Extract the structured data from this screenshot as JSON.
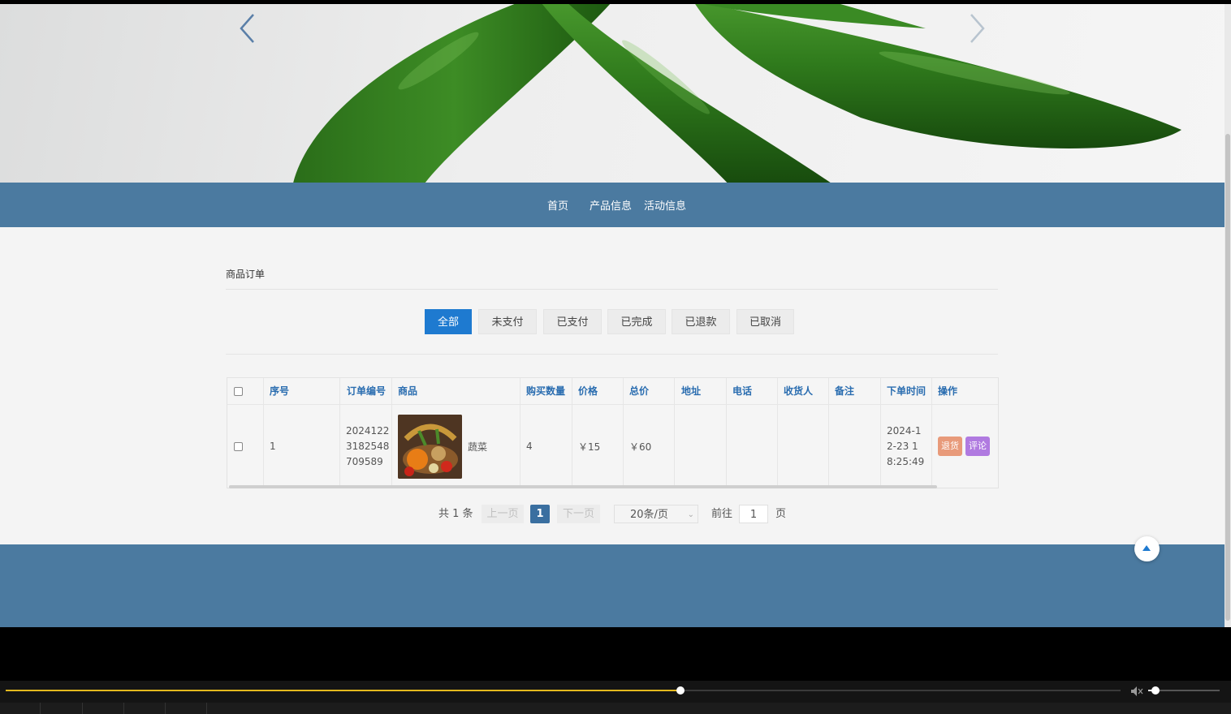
{
  "nav": {
    "items": [
      "首页",
      "产品信息",
      "活动信息"
    ]
  },
  "section": {
    "title": "商品订单"
  },
  "tabs": [
    {
      "label": "全部",
      "active": true
    },
    {
      "label": "未支付",
      "active": false
    },
    {
      "label": "已支付",
      "active": false
    },
    {
      "label": "已完成",
      "active": false
    },
    {
      "label": "已退款",
      "active": false
    },
    {
      "label": "已取消",
      "active": false
    }
  ],
  "table": {
    "headers": [
      "序号",
      "订单编号",
      "商品",
      "购买数量",
      "价格",
      "总价",
      "地址",
      "电话",
      "收货人",
      "备注",
      "下单时间",
      "操作"
    ],
    "rows": [
      {
        "index": "1",
        "order_no": "20241223182548709589",
        "product": "蔬菜",
        "quantity": "4",
        "price": "￥15",
        "total": "￥60",
        "address": "",
        "phone": "",
        "receiver": "",
        "note": "",
        "time": "2024-12-23 18:25:49",
        "actions": [
          "退货",
          "评论"
        ]
      }
    ]
  },
  "pagination": {
    "total": "共 1 条",
    "prev": "上一页",
    "current": "1",
    "next": "下一页",
    "page_size": "20条/页",
    "goto_label": "前往",
    "goto_value": "1",
    "page_unit": "页"
  },
  "player": {
    "progress": 0.6055,
    "volume": 0.1
  },
  "colors": {
    "nav": "#4b7aa0",
    "active_tab": "#1e7ad0",
    "refund": "#e89a7a",
    "review": "#b07ae0",
    "progress": "#e3b91e"
  }
}
